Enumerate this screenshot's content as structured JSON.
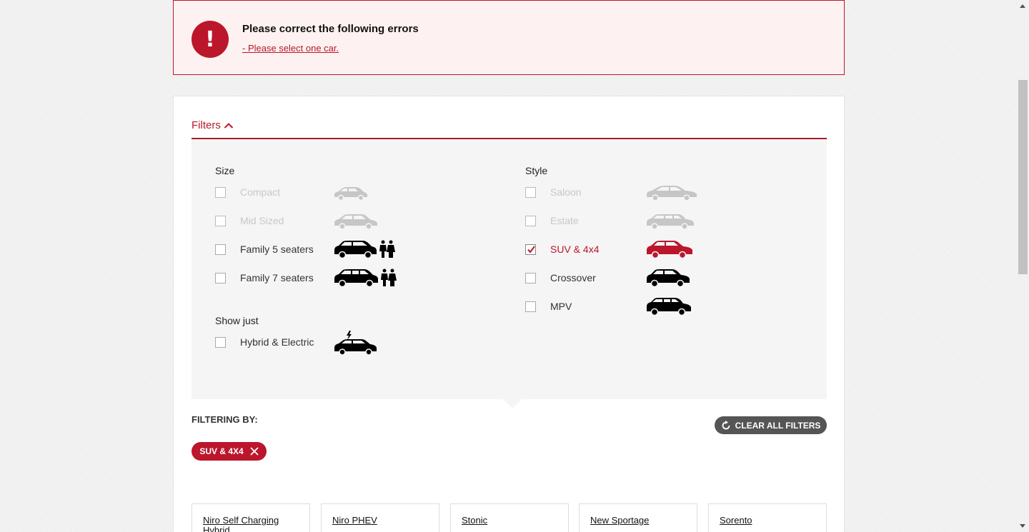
{
  "error": {
    "title": "Please correct the following errors",
    "message": "- Please select one car."
  },
  "filters": {
    "toggle_label": "Filters",
    "size_title": "Size",
    "size_options": [
      {
        "label": "Compact",
        "checked": false,
        "disabled": true
      },
      {
        "label": "Mid Sized",
        "checked": false,
        "disabled": true
      },
      {
        "label": "Family 5 seaters",
        "checked": false,
        "disabled": false
      },
      {
        "label": "Family 7 seaters",
        "checked": false,
        "disabled": false
      }
    ],
    "show_just_title": "Show just",
    "show_just_options": [
      {
        "label": "Hybrid & Electric",
        "checked": false,
        "disabled": false
      }
    ],
    "style_title": "Style",
    "style_options": [
      {
        "label": "Saloon",
        "checked": false,
        "disabled": true
      },
      {
        "label": "Estate",
        "checked": false,
        "disabled": true
      },
      {
        "label": "SUV & 4x4",
        "checked": true,
        "disabled": false
      },
      {
        "label": "Crossover",
        "checked": false,
        "disabled": false
      },
      {
        "label": "MPV",
        "checked": false,
        "disabled": false
      }
    ]
  },
  "filtering_by": {
    "label": "FILTERING BY:",
    "clear_label": "CLEAR ALL FILTERS",
    "active_chip": "SUV & 4X4"
  },
  "models": [
    {
      "name": "Niro Self Charging Hybrid"
    },
    {
      "name": "Niro PHEV"
    },
    {
      "name": "Stonic"
    },
    {
      "name": "New Sportage"
    },
    {
      "name": "Sorento"
    }
  ],
  "colors": {
    "accent": "#bb162b",
    "disabled_icon": "#c6c6c6",
    "enabled_icon": "#000000"
  }
}
